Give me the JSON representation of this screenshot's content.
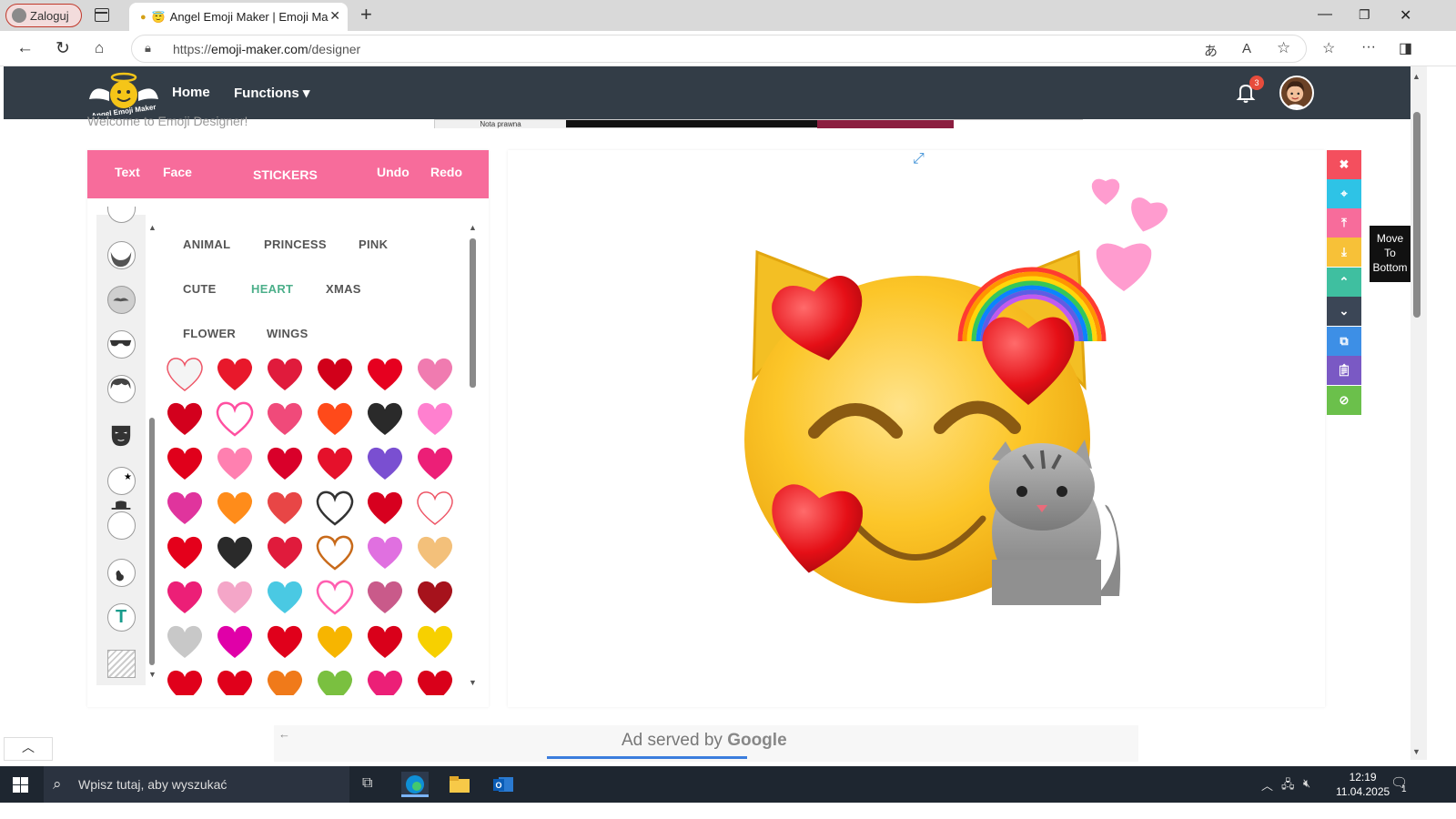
{
  "browser": {
    "profile_label": "Zaloguj",
    "tab_title": "Angel Emoji Maker | Emoji Ma",
    "url_domain_prefix": "https://",
    "url_domain": "emoji-maker.com",
    "url_path": "/designer"
  },
  "site": {
    "nav_home": "Home",
    "nav_functions": "Functions ▾",
    "notification_count": "3",
    "welcome_text": "Welcome to Emoji Designer!",
    "ad_top_label": "Nota prawna"
  },
  "toolbar": {
    "text_label": "Text",
    "face_label": "Face",
    "stickers_label": "STICKERS",
    "undo_label": "Undo",
    "redo_label": "Redo"
  },
  "categories": [
    "ANIMAL",
    "PRINCESS",
    "PINK",
    "CUTE",
    "HEART",
    "XMAS",
    "FLOWER",
    "WINGS"
  ],
  "active_category": "HEART",
  "tooltip_lines": [
    "Move",
    "To",
    "Bottom"
  ],
  "bottom_ad": {
    "text": "Ad served by",
    "brand": "Google"
  },
  "taskbar": {
    "search_placeholder": "Wpisz tutaj, aby wyszukać",
    "time": "12:19",
    "date": "11.04.2025",
    "notification_count": "1"
  },
  "colors": {
    "accent_pink": "#f76c9b",
    "nav_dark": "#333d47",
    "active_category": "#4caf8a"
  }
}
